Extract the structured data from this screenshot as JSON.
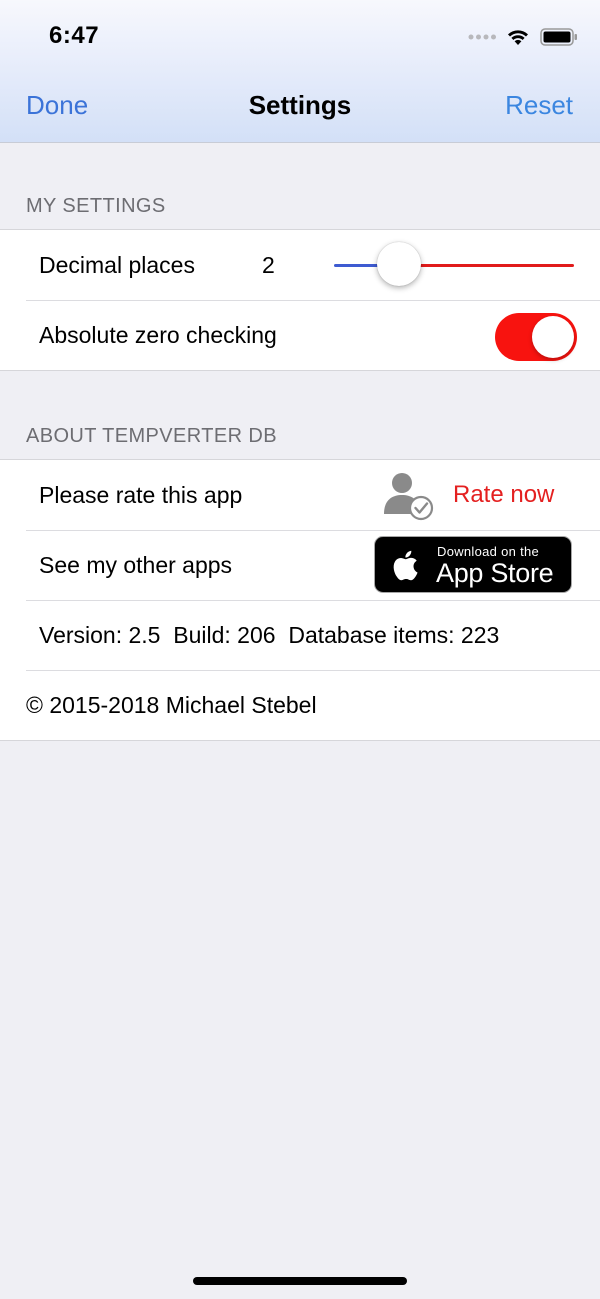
{
  "status_bar": {
    "time": "6:47",
    "icons": [
      "signal-dots-icon",
      "wifi-icon",
      "battery-icon"
    ]
  },
  "nav": {
    "left_label": "Done",
    "title": "Settings",
    "right_label": "Reset"
  },
  "sections": {
    "my_settings": {
      "header": "MY SETTINGS",
      "decimal_places": {
        "label": "Decimal places",
        "value": "2",
        "slider_fraction": 0.27
      },
      "absolute_zero": {
        "label": "Absolute zero checking",
        "on": true
      }
    },
    "about": {
      "header": "ABOUT TEMPVERTER DB",
      "rate": {
        "label": "Please rate this app",
        "icon": "user-check-icon",
        "action": "Rate now"
      },
      "other_apps": {
        "label": "See my other apps",
        "badge_small": "Download on the",
        "badge_big": "App Store",
        "badge_icon": "apple-logo-icon"
      },
      "info": "Version: 2.5  Build: 206  Database items: 223",
      "copyright": "© 2015-2018 Michael Stebel"
    }
  },
  "colors": {
    "nav_blue": "#3b73d8",
    "toggle_on": "#f8130f",
    "slider_min_track": "#3e5bd1",
    "slider_max_track": "#e11b1b",
    "rate_red": "#e42020",
    "background": "#efeff4"
  }
}
